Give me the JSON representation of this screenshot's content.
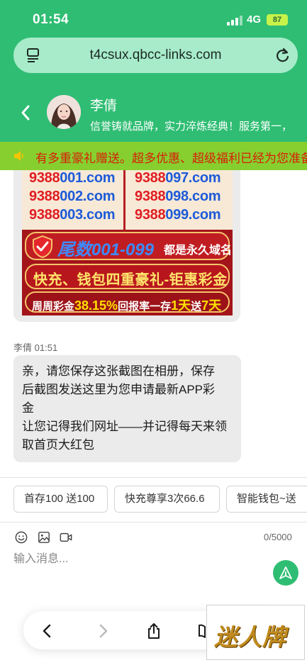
{
  "status_bar": {
    "time": "01:54",
    "network": "4G",
    "battery": "87"
  },
  "browser": {
    "url": "t4csux.qbcc-links.com"
  },
  "chat_header": {
    "agent_name": "李倩",
    "agent_tagline": "信誉铸就品牌，实力淬炼经典！服务第一，"
  },
  "notice": {
    "text": "有多重豪礼赠送。超多优惠、超级福利已经为您准备好"
  },
  "promo_image": {
    "domains_left": [
      {
        "prefix": "9388",
        "suffix": "001.com"
      },
      {
        "prefix": "9388",
        "suffix": "002.com"
      },
      {
        "prefix": "9388",
        "suffix": "003.com"
      }
    ],
    "domains_right": [
      {
        "prefix": "9388",
        "suffix": "097.com"
      },
      {
        "prefix": "9388",
        "suffix": "098.com"
      },
      {
        "prefix": "9388",
        "suffix": "099.com"
      }
    ],
    "line1_big": "尾数001-099",
    "line1_small": "都是永久域名",
    "line2": "快充、钱包四重豪礼-钜惠彩金",
    "line3_a": "周周彩金",
    "line3_b": "38.15%",
    "line3_c": "回报率一存",
    "line3_d": "1天",
    "line3_e": "送",
    "line3_f": "7天"
  },
  "message": {
    "sender": "李倩",
    "time": "01:51",
    "lines": [
      "亲，请您保存这张截图在相册，保存",
      "后截图发送这里为您申请最新APP彩",
      "金",
      "让您记得我们网址——并记得每天来领",
      "取首页大红包"
    ]
  },
  "quick_replies": [
    "首存100 送100",
    "快充尊享3次66.6",
    "智能钱包~送"
  ],
  "composer": {
    "counter": "0/5000",
    "placeholder": "输入消息..."
  },
  "watermark": {
    "text": "迷人牌"
  },
  "colors": {
    "accent": "#2fbd73",
    "notice_bg": "#87cf2f",
    "notice_text": "#d81e06"
  }
}
